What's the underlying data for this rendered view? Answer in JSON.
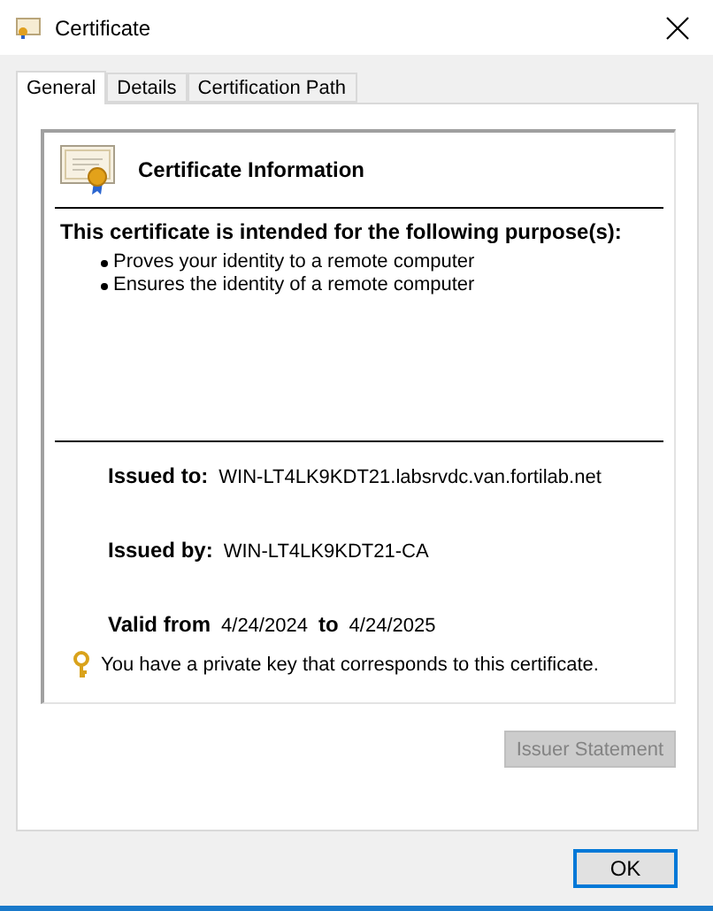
{
  "window": {
    "title": "Certificate"
  },
  "tabs": [
    {
      "label": "General",
      "selected": true
    },
    {
      "label": "Details",
      "selected": false
    },
    {
      "label": "Certification Path",
      "selected": false
    }
  ],
  "info": {
    "heading": "Certificate Information",
    "purpose_title": "This certificate is intended for the following purpose(s):",
    "purposes": [
      "Proves your identity to a remote computer",
      "Ensures the identity of a remote computer"
    ],
    "issued_to": {
      "label": "Issued to:",
      "value": "WIN-LT4LK9KDT21.labsrvdc.van.fortilab.net"
    },
    "issued_by": {
      "label": "Issued by:",
      "value": "WIN-LT4LK9KDT21-CA"
    },
    "validity": {
      "from_label": "Valid from",
      "from": "4/24/2024",
      "to_label": "to",
      "to": "4/24/2025"
    },
    "key_note": "You have a private key that corresponds to this certificate."
  },
  "issuer_button": {
    "label": "Issuer Statement",
    "disabled": true
  },
  "ok_button": {
    "label": "OK"
  }
}
